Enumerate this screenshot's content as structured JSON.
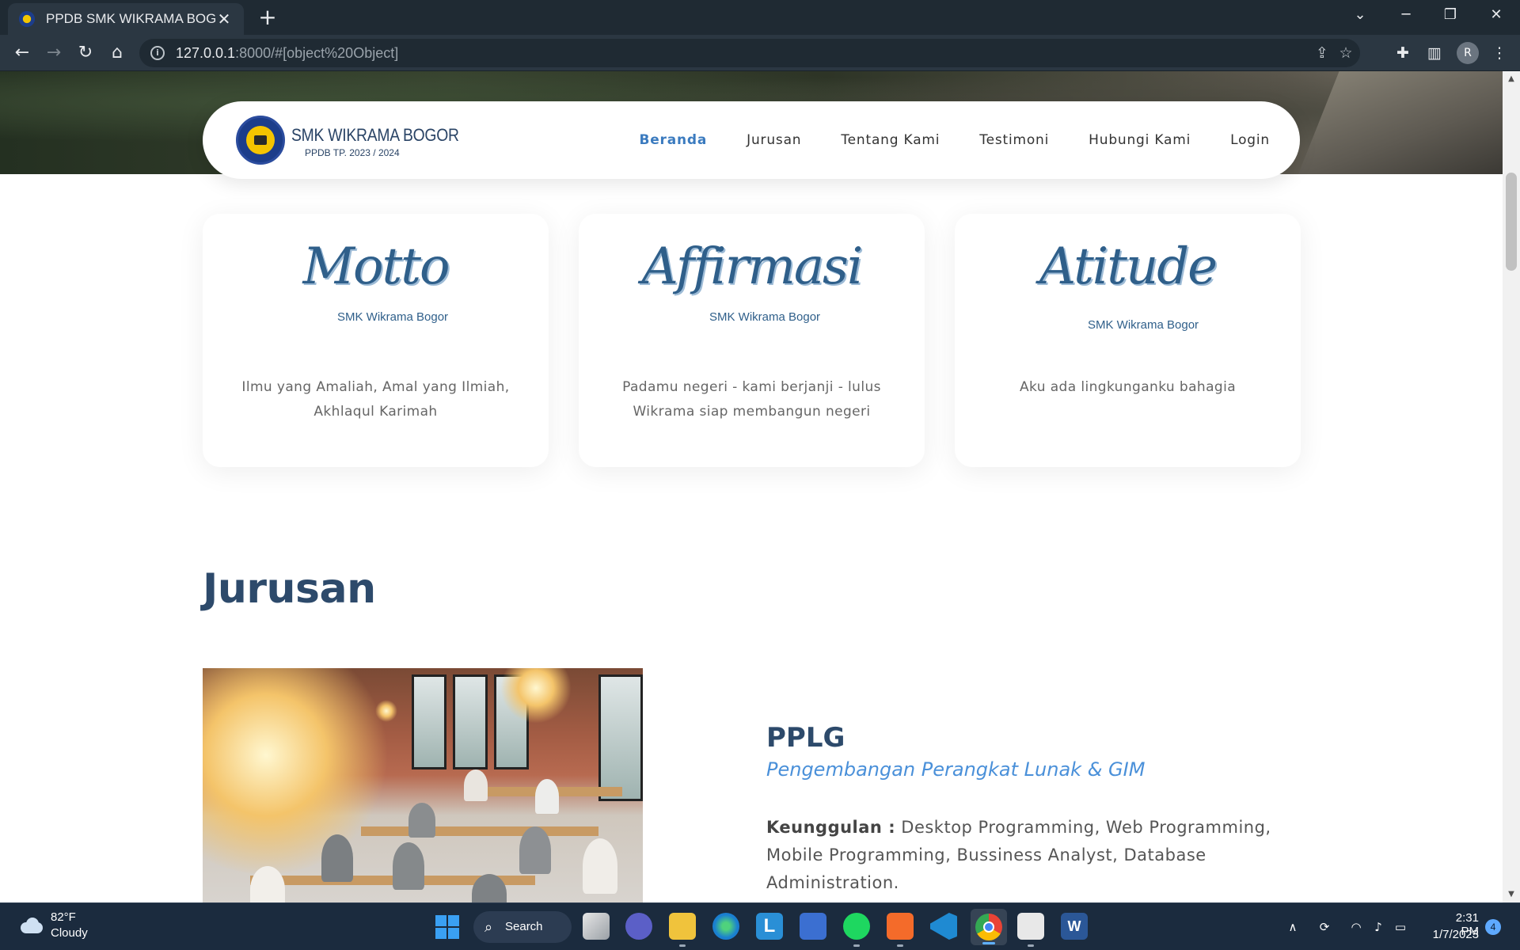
{
  "browser": {
    "tab_title": "PPDB SMK WIKRAMA BOGOR",
    "url_host": "127.0.0.1",
    "url_rest": ":8000/#[object%20Object]",
    "profile_initial": "R"
  },
  "navbar": {
    "brand_name": "SMK WIKRAMA BOGOR",
    "brand_sub": "PPDB TP. 2023 / 2024",
    "menu": [
      "Beranda",
      "Jurusan",
      "Tentang Kami",
      "Testimoni",
      "Hubungi Kami",
      "Login"
    ],
    "active_menu": "Beranda"
  },
  "cards": [
    {
      "script": "Motto",
      "sub": "SMK Wikrama Bogor",
      "desc": "Ilmu yang Amaliah, Amal yang Ilmiah, Akhlaqul Karimah"
    },
    {
      "script": "Affirmasi",
      "sub": "SMK Wikrama Bogor",
      "desc": "Padamu negeri - kami berjanji - lulus Wikrama siap membangun negeri"
    },
    {
      "script": "Atitude",
      "sub": "SMK Wikrama Bogor",
      "desc": "Aku ada lingkunganku bahagia"
    }
  ],
  "jurusan": {
    "title": "Jurusan",
    "code": "PPLG",
    "name": "Pengembangan Perangkat Lunak & GIM",
    "adv_label": "Keunggulan :",
    "adv_text": " Desktop Programming, Web Programming, Mobile Programming, Bussiness Analyst, Database Administration."
  },
  "taskbar": {
    "weather_temp": "82°F",
    "weather_desc": "Cloudy",
    "search_label": "Search",
    "time": "2:31 PM",
    "date": "1/7/2023",
    "notification_count": "4"
  },
  "colors": {
    "accent_blue": "#3b7bbf",
    "heading_navy": "#2d4a6b",
    "subtitle_blue": "#4a90d9"
  }
}
